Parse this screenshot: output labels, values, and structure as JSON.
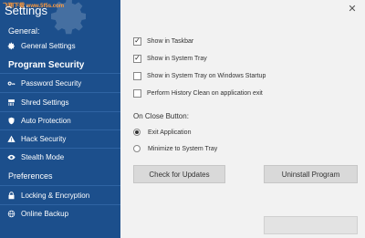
{
  "window": {
    "title": "Settings",
    "watermark": "飞翔下载 www.5f5s.com"
  },
  "sidebar": {
    "sections": [
      {
        "label": "General:"
      },
      {
        "label": "Program Security"
      },
      {
        "label": "Preferences"
      }
    ],
    "items": [
      {
        "label": "General Settings",
        "icon": "gear-icon"
      },
      {
        "label": "Password Security",
        "icon": "key-icon"
      },
      {
        "label": "Shred Settings",
        "icon": "shredder-icon"
      },
      {
        "label": "Auto Protection",
        "icon": "shield-icon"
      },
      {
        "label": "Hack Security",
        "icon": "warning-icon"
      },
      {
        "label": "Stealth Mode",
        "icon": "eye-icon"
      },
      {
        "label": "Locking & Encryption",
        "icon": "lock-icon"
      },
      {
        "label": "Online Backup",
        "icon": "globe-icon"
      }
    ],
    "active_index": 0
  },
  "main": {
    "options": [
      {
        "label": "Show in Taskbar",
        "checked": true
      },
      {
        "label": "Show in System Tray",
        "checked": true
      },
      {
        "label": "Show in System Tray on Windows Startup",
        "checked": false
      },
      {
        "label": "Perform History Clean on application exit",
        "checked": false
      }
    ],
    "close_group": {
      "label": "On Close Button:",
      "options": [
        {
          "label": "Exit Application",
          "selected": true
        },
        {
          "label": "Minimize to System Tray",
          "selected": false
        }
      ]
    },
    "buttons": {
      "check_updates": "Check for Updates",
      "uninstall": "Uninstall Program"
    }
  },
  "colors": {
    "sidebar_bg": "#1c4f8c",
    "main_bg": "#f2f2f2"
  }
}
